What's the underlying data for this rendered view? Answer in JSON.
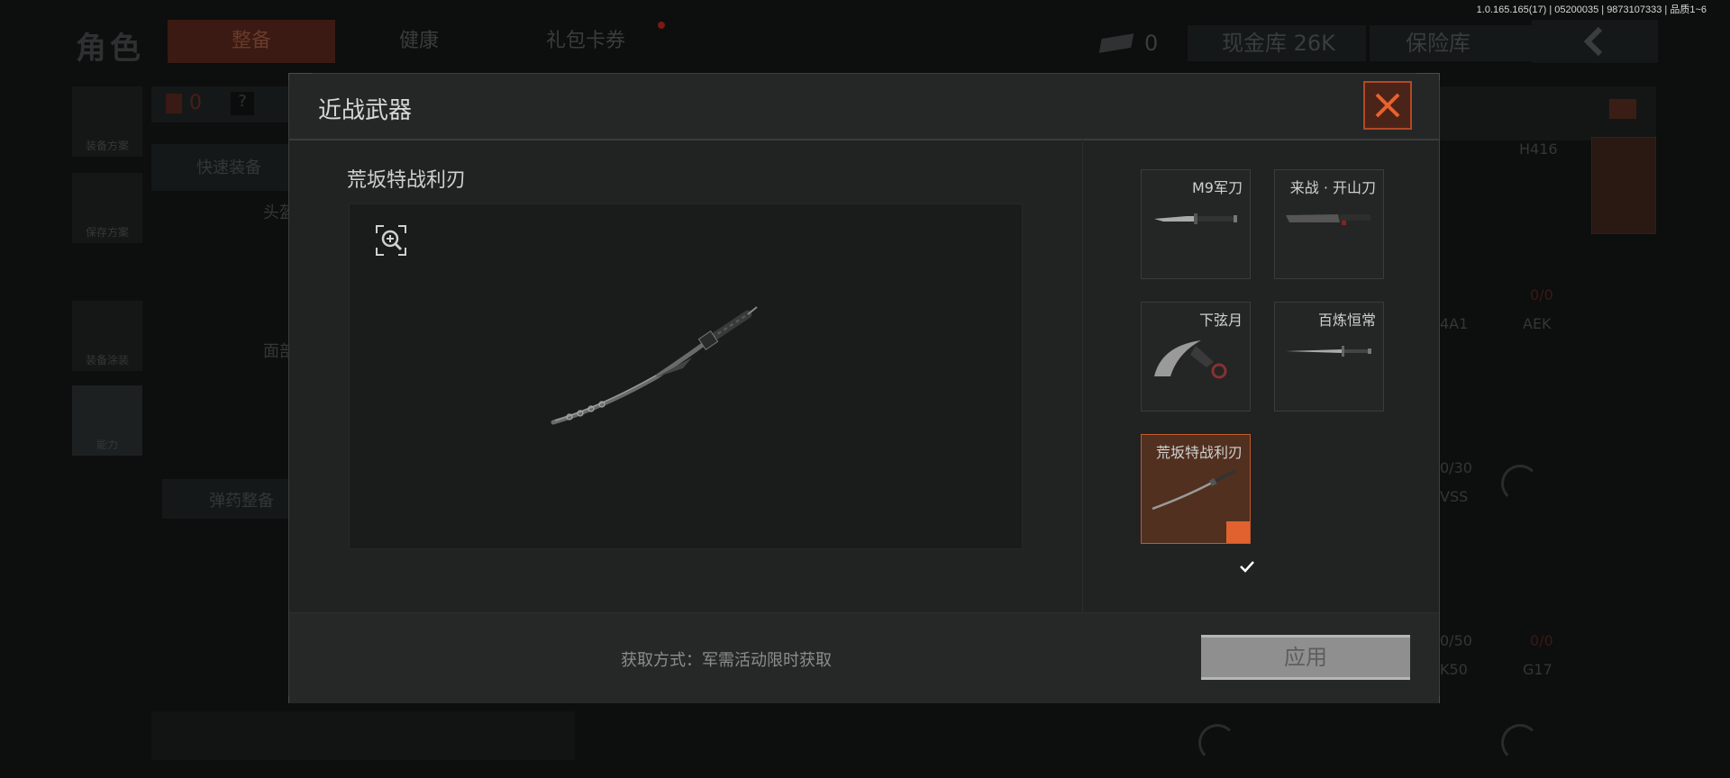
{
  "version_info": "1.0.165.165(17) | 05200035 | 9873107333 | 品质1~6",
  "background": {
    "title": "角色",
    "tabs": [
      "整备",
      "健康",
      "礼包卡券"
    ],
    "ticket_count": "0",
    "cash_vault": "现金库 26K",
    "safe_box": "保险库",
    "badge_count": "0",
    "help": "?",
    "side_buttons": [
      "装备方案",
      "保存方案",
      "装备涂装",
      "能力"
    ],
    "quick_equip": "快速装备",
    "ammo_equip": "弹药整备",
    "slot_head": "头盔",
    "slot_face": "面部",
    "weapon_labels": [
      "H416",
      "AEK",
      "G17",
      "4A1",
      "VSS",
      "K50"
    ],
    "ammo_counts": [
      "0/0",
      "0/30",
      "0/50",
      "0/0"
    ]
  },
  "modal": {
    "title": "近战武器",
    "item_name": "荒坂特战利刃",
    "zoom_icon": "zoom-in-icon",
    "close_icon": "close-icon",
    "cards": [
      {
        "label": "M9军刀",
        "icon": "combat-knife-icon",
        "selected": false
      },
      {
        "label": "来战 · 开山刀",
        "icon": "machete-icon",
        "selected": false
      },
      {
        "label": "下弦月",
        "icon": "karambit-icon",
        "selected": false
      },
      {
        "label": "百炼恒常",
        "icon": "long-sword-icon",
        "selected": false
      },
      {
        "label": "荒坂特战利刃",
        "icon": "katana-icon",
        "selected": true
      }
    ],
    "acquire_method": "获取方式：军需活动限时获取",
    "apply_button": "应用"
  },
  "colors": {
    "accent": "#e0622f",
    "selected_bg": "#51301f",
    "modal_bg": "#212222"
  }
}
